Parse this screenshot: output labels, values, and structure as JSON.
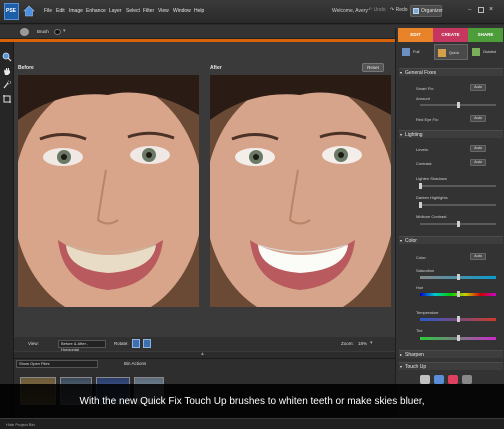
{
  "app": {
    "logo_text": "PSE",
    "menu": [
      "File",
      "Edit",
      "Image",
      "Enhance",
      "Layer",
      "Select",
      "Filter",
      "View",
      "Window",
      "Help"
    ],
    "welcome": "Welcome, Avery",
    "undo_label": "Undo",
    "redo_label": "Redo",
    "organizer_label": "Organizer"
  },
  "options_bar": {
    "tool_label": "Brush"
  },
  "workspace": {
    "before_label": "Before",
    "after_label": "After",
    "reset_label": "Reset",
    "view_label": "View:",
    "view_value": "Before & After - Horizontal",
    "rotate_label": "Rotate:",
    "zoom_label": "Zoom:",
    "zoom_value": "18%"
  },
  "project_bin": {
    "select_value": "Show Open Files",
    "bin_actions": "Bin Actions"
  },
  "panel": {
    "tabs": [
      "EDIT",
      "CREATE",
      "SHARE"
    ],
    "tab_colors": [
      "#e8832a",
      "#c6375f",
      "#4d9e3b"
    ],
    "modes": [
      "Full",
      "Quick",
      "Guided"
    ],
    "sections": {
      "general": "General Fixes",
      "lighting": "Lighting",
      "color": "Color",
      "sharpen": "Sharpen",
      "touch_up": "Touch Up"
    },
    "general_fixes": {
      "smart_fix": "Smart Fix:",
      "amount": "Amount",
      "red_eye": "Red Eye Fix:",
      "auto": "Auto",
      "amount_value": 0.5
    },
    "lighting": {
      "levels": "Levels:",
      "contrast": "Contrast:",
      "shadows": "Lighten Shadows",
      "highlights": "Darken Highlights",
      "midtone": "Midtone Contrast",
      "auto": "Auto",
      "shadows_value": 0.0,
      "highlights_value": 0.0,
      "midtone_value": 0.5
    },
    "color": {
      "color_label": "Color:",
      "saturation": "Saturation",
      "hue": "Hue",
      "temperature": "Temperature",
      "tint": "Tint",
      "auto": "Auto",
      "saturation_value": 0.5,
      "hue_value": 0.5,
      "temperature_value": 0.5,
      "tint_value": 0.5
    }
  },
  "caption": "With the new Quick Fix Touch Up brushes to whiten teeth or make skies bluer,",
  "status_text": "Hide Project Bin"
}
